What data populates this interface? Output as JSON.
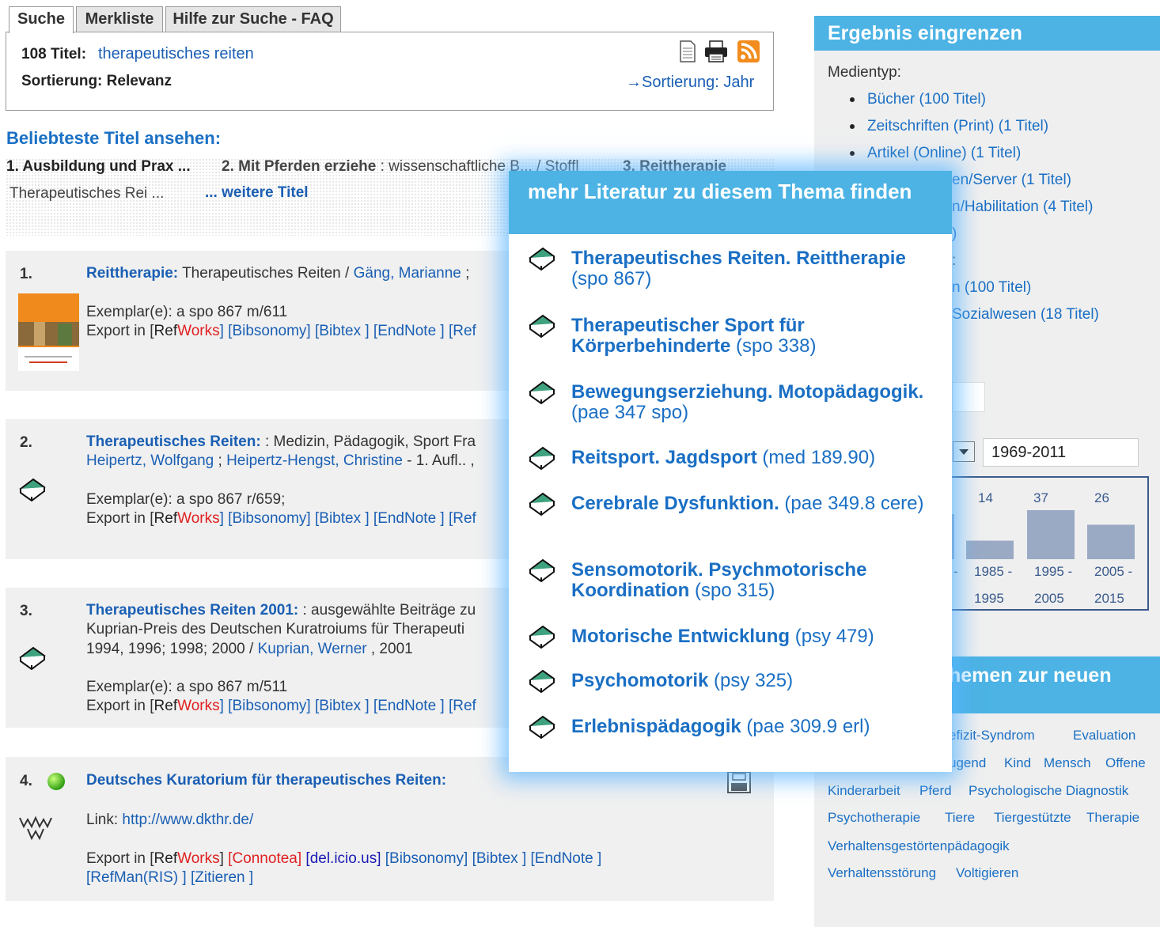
{
  "tabs": [
    "Suche",
    "Merkliste",
    "Hilfe zur Suche - FAQ"
  ],
  "search": {
    "count_label": "108 Titel:",
    "query": "therapeutisches reiten",
    "sort_label": "Sortierung: Relevanz",
    "sort_alt": "→Sortierung: Jahr"
  },
  "popular": {
    "heading": "Beliebteste Titel ansehen:",
    "item1": "1. Ausbildung und Prax ...",
    "item2_bold": "2. Mit Pferden erziehe",
    "item2_rest": " : wissenschaftliche B... / Stoffl",
    "item3": "3. Reittherapie",
    "item4": "Therapeutisches Rei ...",
    "more": "... weitere Titel"
  },
  "results": [
    {
      "num": "1.",
      "title": "Reittherapie:",
      "rest": " Therapeutisches Reiten / ",
      "author": "Gäng, Marianne",
      "tail": " ;",
      "exemplar": "Exemplar(e):   a spo 867 m/611",
      "export_prefix": "Export in [",
      "ref": "Ref",
      "works": "Works",
      "links": "] [Bibsonomy] [Bibtex ] [EndNote ] [Ref"
    },
    {
      "num": "2.",
      "title": "Therapeutisches Reiten:",
      "rest": " : Medizin, Pädagogik, Sport  Fra",
      "line2a": "Heipertz, Wolfgang",
      "line2b": " ; ",
      "line2c": "Heipertz-Hengst, Christine",
      "line2d": " - 1. Aufl.. ,",
      "exemplar": "Exemplar(e):   a spo 867 r/659;",
      "export_prefix": "Export in [",
      "ref": "Ref",
      "works": "Works",
      "links": "] [Bibsonomy] [Bibtex ] [EndNote ] [Ref"
    },
    {
      "num": "3.",
      "title": "Therapeutisches Reiten 2001:",
      "rest": " : ausgewählte Beiträge zu",
      "line2": "Kuprian-Preis des Deutschen Kuratroiums für Therapeuti",
      "line3a": "1994, 1996; 1998; 2000 / ",
      "line3b": "Kuprian, Werner",
      "line3c": " , 2001",
      "exemplar": "Exemplar(e):   a spo 867 m/511",
      "export_prefix": "Export in [",
      "ref": "Ref",
      "works": "Works",
      "links": "] [Bibsonomy] [Bibtex ] [EndNote ] [Ref"
    },
    {
      "num": "4.",
      "title": "Deutsches Kuratorium für therapeutisches Reiten:",
      "link_label": "Link: ",
      "url": "http://www.dkthr.de/",
      "export_prefix": "Export in [",
      "ref": "Ref",
      "works": "Works",
      "connotea": "[Connotea]",
      "delicious": "[del.icio.us]",
      "links": "[Bibsonomy] [Bibtex ] [EndNote ]",
      "links2": "[RefMan(RIS) ] [Zitieren ]"
    }
  ],
  "right_panel": {
    "heading": "Ergebnis eingrenzen",
    "medientyp": "Medientyp:",
    "media": [
      "Bücher (100 Titel)",
      "Zeitschriften (Print) (1 Titel)",
      "Artikel (Online) (1 Titel)"
    ],
    "partial": [
      "en/Server (1 Titel)",
      "n/Habilitation (4 Titel)",
      ")",
      ":",
      "n (100 Titel)",
      "Sozialwesen (18 Titel)"
    ],
    "year_range": "1969-2011",
    "histogram_counts": [
      "14",
      "37",
      "26"
    ],
    "histogram_labels_top": [
      "-",
      "1985 -",
      "1995 -",
      "2005 -"
    ],
    "histogram_labels_bottom": [
      "1995",
      "2005",
      "2015"
    ],
    "themen_heading": "hemen zur neuen",
    "tags": {
      "r1": [
        "efizit-Syndrom",
        "Evaluation"
      ],
      "r2": [
        "ugend",
        "Kind",
        "Mensch",
        "Offene"
      ],
      "r3": [
        "Kinderarbeit",
        "Pferd",
        "Psychologische Diagnostik"
      ],
      "r4": [
        "Psychotherapie",
        "Tiere",
        "Tiergestützte",
        "Therapie"
      ],
      "r5": [
        "Verhaltensgestörtenpädagogik"
      ],
      "r6": [
        "Verhaltensstörung",
        "Voltigieren"
      ]
    }
  },
  "histogram": {
    "values": [
      14,
      37,
      26
    ]
  },
  "popup": {
    "heading": "mehr Literatur zu diesem Thema finden",
    "items": [
      {
        "bold": "Therapeutisches Reiten. Reittherapie",
        "call": " (spo 867)"
      },
      {
        "bold": "Therapeutischer Sport für Körperbehinderte",
        "call": " (spo 338)"
      },
      {
        "bold": "Bewegungserziehung. Motopädagogik.",
        "call": " (pae 347 spo)"
      },
      {
        "bold": "Reitsport. Jagdsport",
        "call": " (med 189.90)"
      },
      {
        "bold": "Cerebrale Dysfunktion.",
        "call": " (pae 349.8 cere)"
      },
      {
        "bold": "Sensomotorik. Psychmotorische Koordination",
        "call": " (spo 315)"
      },
      {
        "bold": "Motorische Entwicklung",
        "call": " (psy 479)"
      },
      {
        "bold": "Psychomotorik",
        "call": " (psy 325)"
      },
      {
        "bold": "Erlebnispädagogik",
        "call": " (pae 309.9 erl)"
      }
    ]
  },
  "colors": {
    "accent": "#4cb3e4",
    "link": "#1a6fc4",
    "red": "#e02020",
    "bar": "#9aaac4"
  }
}
